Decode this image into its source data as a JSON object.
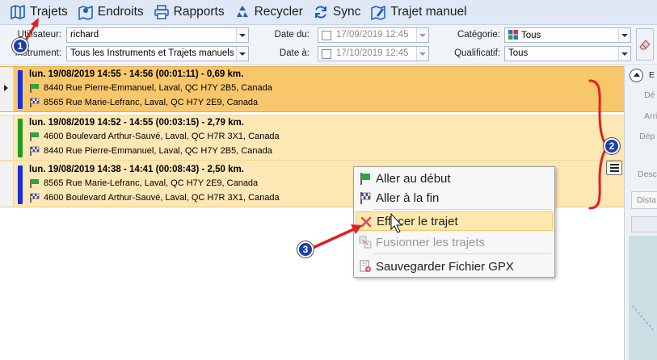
{
  "toolbar": {
    "items": [
      {
        "label": "Trajets",
        "icon": "map-icon"
      },
      {
        "label": "Endroits",
        "icon": "map-pin-icon"
      },
      {
        "label": "Rapports",
        "icon": "printer-icon"
      },
      {
        "label": "Recycler",
        "icon": "recycle-icon"
      },
      {
        "label": "Sync",
        "icon": "sync-icon"
      },
      {
        "label": "Trajet manuel",
        "icon": "manual-trip-icon"
      }
    ]
  },
  "filters": {
    "user_label": "Utilisateur:",
    "user_value": "richard",
    "instrument_label": "Instrument:",
    "instrument_value": "Tous les Instruments et Trajets manuels",
    "date_from_label": "Date du:",
    "date_from_value": "17/09/2019 12:45",
    "date_to_label": "Date à:",
    "date_to_value": "17/10/2019 12:45",
    "category_label": "Catégorie:",
    "category_value": "Tous",
    "qualifier_label": "Qualificatif:",
    "qualifier_value": "Tous"
  },
  "trips": [
    {
      "header": "lun. 19/08/2019  14:55 - 14:56  (00:01:11) - 0,69 km.",
      "start": "8440 Rue Pierre-Emmanuel, Laval, QC H7Y 2B5, Canada",
      "end": "8565 Rue Marie-Lefranc, Laval, QC H7Y 2E9, Canada",
      "color": "#1a2fd6",
      "selected": true
    },
    {
      "header": "lun. 19/08/2019  14:52 - 14:55  (00:03:15) - 2,79 km.",
      "start": "4600 Boulevard Arthur-Sauvé, Laval, QC H7R 3X1, Canada",
      "end": "8440 Rue Pierre-Emmanuel, Laval, QC H7Y 2B5, Canada",
      "color": "#1f9a24",
      "selected": false
    },
    {
      "header": "lun. 19/08/2019  14:38 - 14:41  (00:08:43) - 2,50 km.",
      "start": "8565 Rue Marie-Lefranc, Laval, QC H7Y 2E9, Canada",
      "end": "4600 Boulevard Arthur-Sauvé, Laval, QC H7R 3X1, Canada",
      "color": "#1a2fd6",
      "selected": false
    }
  ],
  "context_menu": {
    "items": [
      {
        "label": "Aller au début",
        "icon": "start-flag-icon"
      },
      {
        "label": "Aller à la fin",
        "icon": "finish-flag-icon"
      },
      {
        "label": "Effacer le trajet",
        "icon": "delete-icon"
      },
      {
        "label": "Fusionner les trajets",
        "icon": "merge-icon"
      },
      {
        "label": "Sauvegarder Fichier GPX",
        "icon": "save-gpx-icon"
      }
    ]
  },
  "right_panel": {
    "labels": [
      "E",
      "Dé",
      "Arri",
      "Dép",
      "Desc",
      "Dista"
    ]
  },
  "annotations": {
    "badges": [
      "1",
      "2",
      "3"
    ],
    "color": "#e02020"
  }
}
